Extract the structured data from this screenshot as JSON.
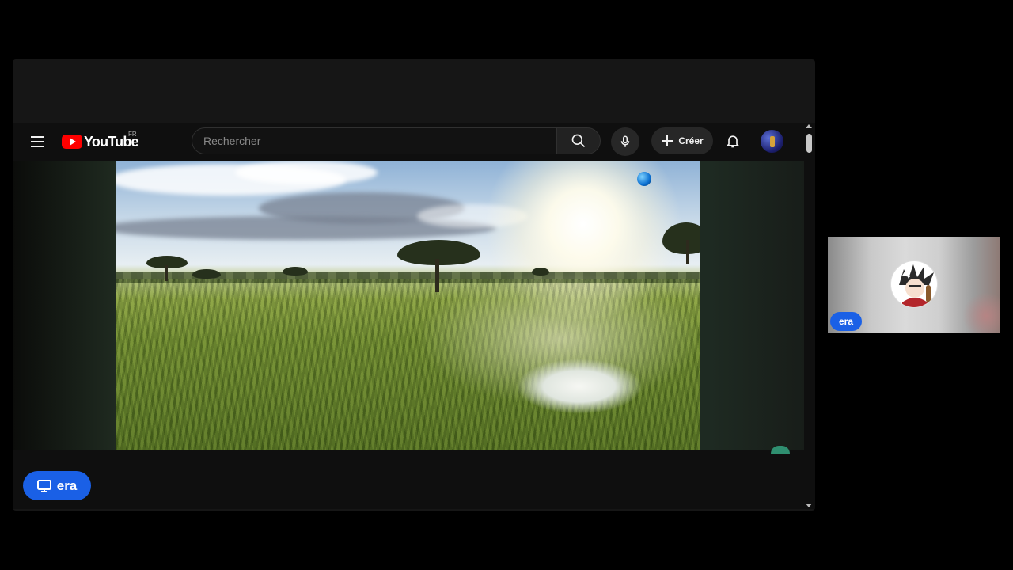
{
  "youtube": {
    "logo_text": "YouTube",
    "country_code": "FR",
    "search_placeholder": "Rechercher",
    "create_label": "Créer",
    "icons": {
      "menu": "menu-icon",
      "search": "search-icon",
      "mic": "mic-icon",
      "create": "plus-icon",
      "notifications": "bell-icon"
    }
  },
  "presenter": {
    "label": "era",
    "icon": "screen-share-icon",
    "color": "#1a60e6"
  },
  "participant": {
    "name": "era"
  }
}
